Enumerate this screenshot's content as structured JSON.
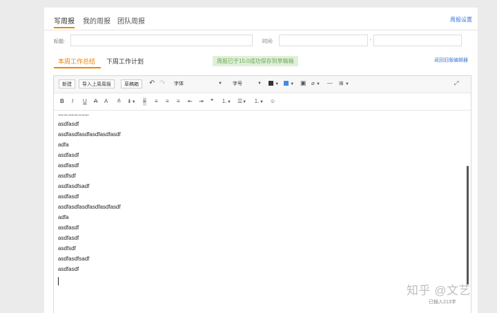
{
  "nav": {
    "tabs": [
      {
        "label": "写周报"
      },
      {
        "label": "我的周报"
      },
      {
        "label": "团队周报"
      }
    ],
    "settings_label": "周报设置"
  },
  "form": {
    "title_label": "标题:",
    "time_label": "时间:",
    "time_separator": "-",
    "title_value": "",
    "time_start_value": "",
    "time_end_value": ""
  },
  "subtabs": {
    "current": "本周工作总结",
    "next": "下周工作计划"
  },
  "save_status": "周报已于15:0成功保存到草稿箱",
  "old_editor_link": "返回旧版编辑器",
  "toolbar": {
    "new_label": "新建",
    "import_label": "导入上周周报",
    "draft_label": "草稿箱",
    "font_label": "字体",
    "size_label": "字号",
    "font_color": "#333333",
    "highlight_color": "#3d8fe0"
  },
  "content": {
    "lines": [
      "asdfasdfsadf",
      "asdfasdf",
      "asdfasdfasdfasdfasdfasdf",
      "adfa",
      "asdfasdf",
      "asdfasdf",
      "asdfsdf",
      "asdfasdfsadf",
      "asdfasdf",
      "asdfasdfasdfasdfasdfasdf",
      "adfa",
      "asdfasdf",
      "asdfasdf",
      "asdfsdf",
      "asdfasdfsadf",
      "asdfasdf"
    ]
  },
  "word_count": "已输入213字",
  "watermark": "知乎 @文艺",
  "colors": {
    "accent": "#f08200",
    "link": "#3c78d8",
    "save_bg": "#dff0d8",
    "save_text": "#71a85a"
  }
}
